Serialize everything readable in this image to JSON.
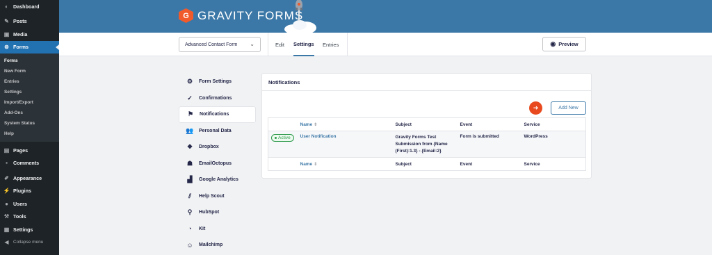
{
  "admin_menu": {
    "items": [
      {
        "label": "Dashboard",
        "icon": "dashboard-icon"
      },
      {
        "label": "Posts",
        "icon": "pin-icon"
      },
      {
        "label": "Media",
        "icon": "media-icon"
      },
      {
        "label": "Forms",
        "icon": "forms-icon"
      }
    ],
    "forms_sub": [
      "Forms",
      "New Form",
      "Entries",
      "Settings",
      "Import/Export",
      "Add-Ons",
      "System Status",
      "Help"
    ],
    "items_after": [
      {
        "label": "Pages",
        "icon": "pages-icon"
      },
      {
        "label": "Comments",
        "icon": "comment-icon"
      },
      {
        "label": "Appearance",
        "icon": "brush-icon"
      },
      {
        "label": "Plugins",
        "icon": "plug-icon"
      },
      {
        "label": "Users",
        "icon": "user-icon"
      },
      {
        "label": "Tools",
        "icon": "wrench-icon"
      },
      {
        "label": "Settings",
        "icon": "settings-icon"
      }
    ],
    "collapse": "Collapse menu"
  },
  "header": {
    "logo_text": "GRAVITY FORMS",
    "logo_letter": "G",
    "brand_color": "#3c78a7",
    "accent_color": "#f15a2b"
  },
  "toolbar": {
    "form_selected": "Advanced Contact Form",
    "tabs": [
      "Edit",
      "Settings",
      "Entries"
    ],
    "active_tab": "Settings",
    "preview_label": "Preview"
  },
  "settings_nav": {
    "items": [
      {
        "label": "Form Settings",
        "icon": "gear-icon"
      },
      {
        "label": "Confirmations",
        "icon": "check-circle-icon"
      },
      {
        "label": "Notifications",
        "icon": "flag-icon"
      },
      {
        "label": "Personal Data",
        "icon": "people-icon"
      },
      {
        "label": "Dropbox",
        "icon": "dropbox-icon"
      },
      {
        "label": "EmailOctopus",
        "icon": "octopus-icon"
      },
      {
        "label": "Google Analytics",
        "icon": "analytics-icon"
      },
      {
        "label": "Help Scout",
        "icon": "helpscout-icon"
      },
      {
        "label": "HubSpot",
        "icon": "hubspot-icon"
      },
      {
        "label": "Kit",
        "icon": "kit-icon"
      },
      {
        "label": "Mailchimp",
        "icon": "mailchimp-icon"
      }
    ],
    "active": "Notifications"
  },
  "panel": {
    "title": "Notifications",
    "add_new_label": "Add New",
    "columns": [
      "Name",
      "Subject",
      "Event",
      "Service"
    ],
    "rows": [
      {
        "status": "Active",
        "name": "User Notification",
        "subject": "Gravity Forms Test Submission from {Name (First):1.3} - {Email:2}",
        "event": "Form is submitted",
        "service": "WordPress"
      }
    ]
  }
}
